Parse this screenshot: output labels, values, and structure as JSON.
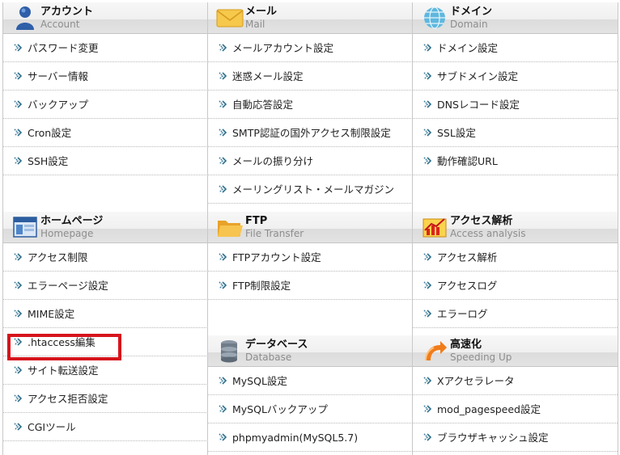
{
  "account": {
    "title": "アカウント",
    "subtitle": "Account",
    "icon": "user-icon",
    "items": [
      "パスワード変更",
      "サーバー情報",
      "バックアップ",
      "Cron設定",
      "SSH設定"
    ]
  },
  "mail": {
    "title": "メール",
    "subtitle": "Mail",
    "icon": "envelope-icon",
    "items": [
      "メールアカウント設定",
      "迷惑メール設定",
      "自動応答設定",
      "SMTP認証の国外アクセス制限設定",
      "メールの振り分け",
      "メーリングリスト・メールマガジン"
    ]
  },
  "domain": {
    "title": "ドメイン",
    "subtitle": "Domain",
    "icon": "globe-icon",
    "items": [
      "ドメイン設定",
      "サブドメイン設定",
      "DNSレコード設定",
      "SSL設定",
      "動作確認URL"
    ]
  },
  "homepage": {
    "title": "ホームページ",
    "subtitle": "Homepage",
    "icon": "browser-window-icon",
    "items": [
      "アクセス制限",
      "エラーページ設定",
      "MIME設定",
      ".htaccess編集",
      "サイト転送設定",
      "アクセス拒否設定",
      "CGIツール"
    ]
  },
  "ftp": {
    "title": "FTP",
    "subtitle": "File Transfer",
    "icon": "folder-icon",
    "items": [
      "FTPアカウント設定",
      "FTP制限設定"
    ]
  },
  "analytics": {
    "title": "アクセス解析",
    "subtitle": "Access analysis",
    "icon": "bar-chart-icon",
    "items": [
      "アクセス解析",
      "アクセスログ",
      "エラーログ"
    ]
  },
  "database": {
    "title": "データベース",
    "subtitle": "Database",
    "icon": "database-icon",
    "items": [
      "MySQL設定",
      "MySQLバックアップ",
      "phpmyadmin(MySQL5.7)"
    ]
  },
  "speed": {
    "title": "高速化",
    "subtitle": "Speeding Up",
    "icon": "speed-arrow-icon",
    "items": [
      "Xアクセラレータ",
      "mod_pagespeed設定",
      "ブラウザキャッシュ設定"
    ]
  },
  "colors": {
    "highlight": "#d6141c",
    "link_arrow": "#3a7d9a"
  }
}
